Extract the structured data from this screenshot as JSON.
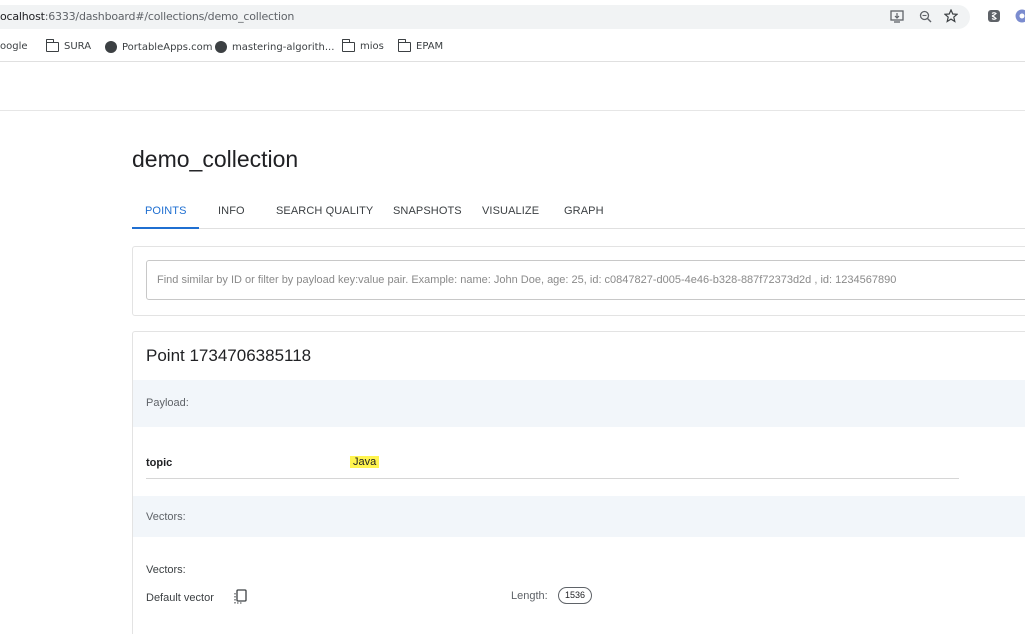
{
  "browser": {
    "url_host": "ocalhost",
    "url_rest": ":6333/dashboard#/collections/demo_collection",
    "bookmarks": [
      {
        "label": "oogle",
        "icon": "none"
      },
      {
        "label": "SURA",
        "icon": "folder-icon"
      },
      {
        "label": "PortableApps.com",
        "icon": "portableapps-icon"
      },
      {
        "label": "mastering-algorith...",
        "icon": "github-icon"
      },
      {
        "label": "mios",
        "icon": "folder-icon"
      },
      {
        "label": "EPAM",
        "icon": "folder-icon"
      }
    ]
  },
  "page": {
    "title": "demo_collection",
    "tabs": [
      {
        "label": "POINTS",
        "active": true
      },
      {
        "label": "INFO",
        "active": false
      },
      {
        "label": "SEARCH QUALITY",
        "active": false
      },
      {
        "label": "SNAPSHOTS",
        "active": false
      },
      {
        "label": "VISUALIZE",
        "active": false
      },
      {
        "label": "GRAPH",
        "active": false
      }
    ],
    "search_placeholder": "Find similar by ID or filter by payload key:value pair. Example: name: John Doe, age: 25, id: c0847827-d005-4e46-b328-887f72373d2d , id: 1234567890"
  },
  "point": {
    "title": "Point 1734706385118",
    "payload_label": "Payload:",
    "payload": {
      "key": "topic",
      "value": "Java"
    },
    "vectors_section_label": "Vectors:",
    "vectors_heading": "Vectors:",
    "vector_name": "Default vector",
    "length_label": "Length:",
    "length_value": "1536"
  },
  "colors": {
    "accent": "#1f6fd1",
    "highlight": "#fff44f",
    "band": "#f2f6fa"
  }
}
